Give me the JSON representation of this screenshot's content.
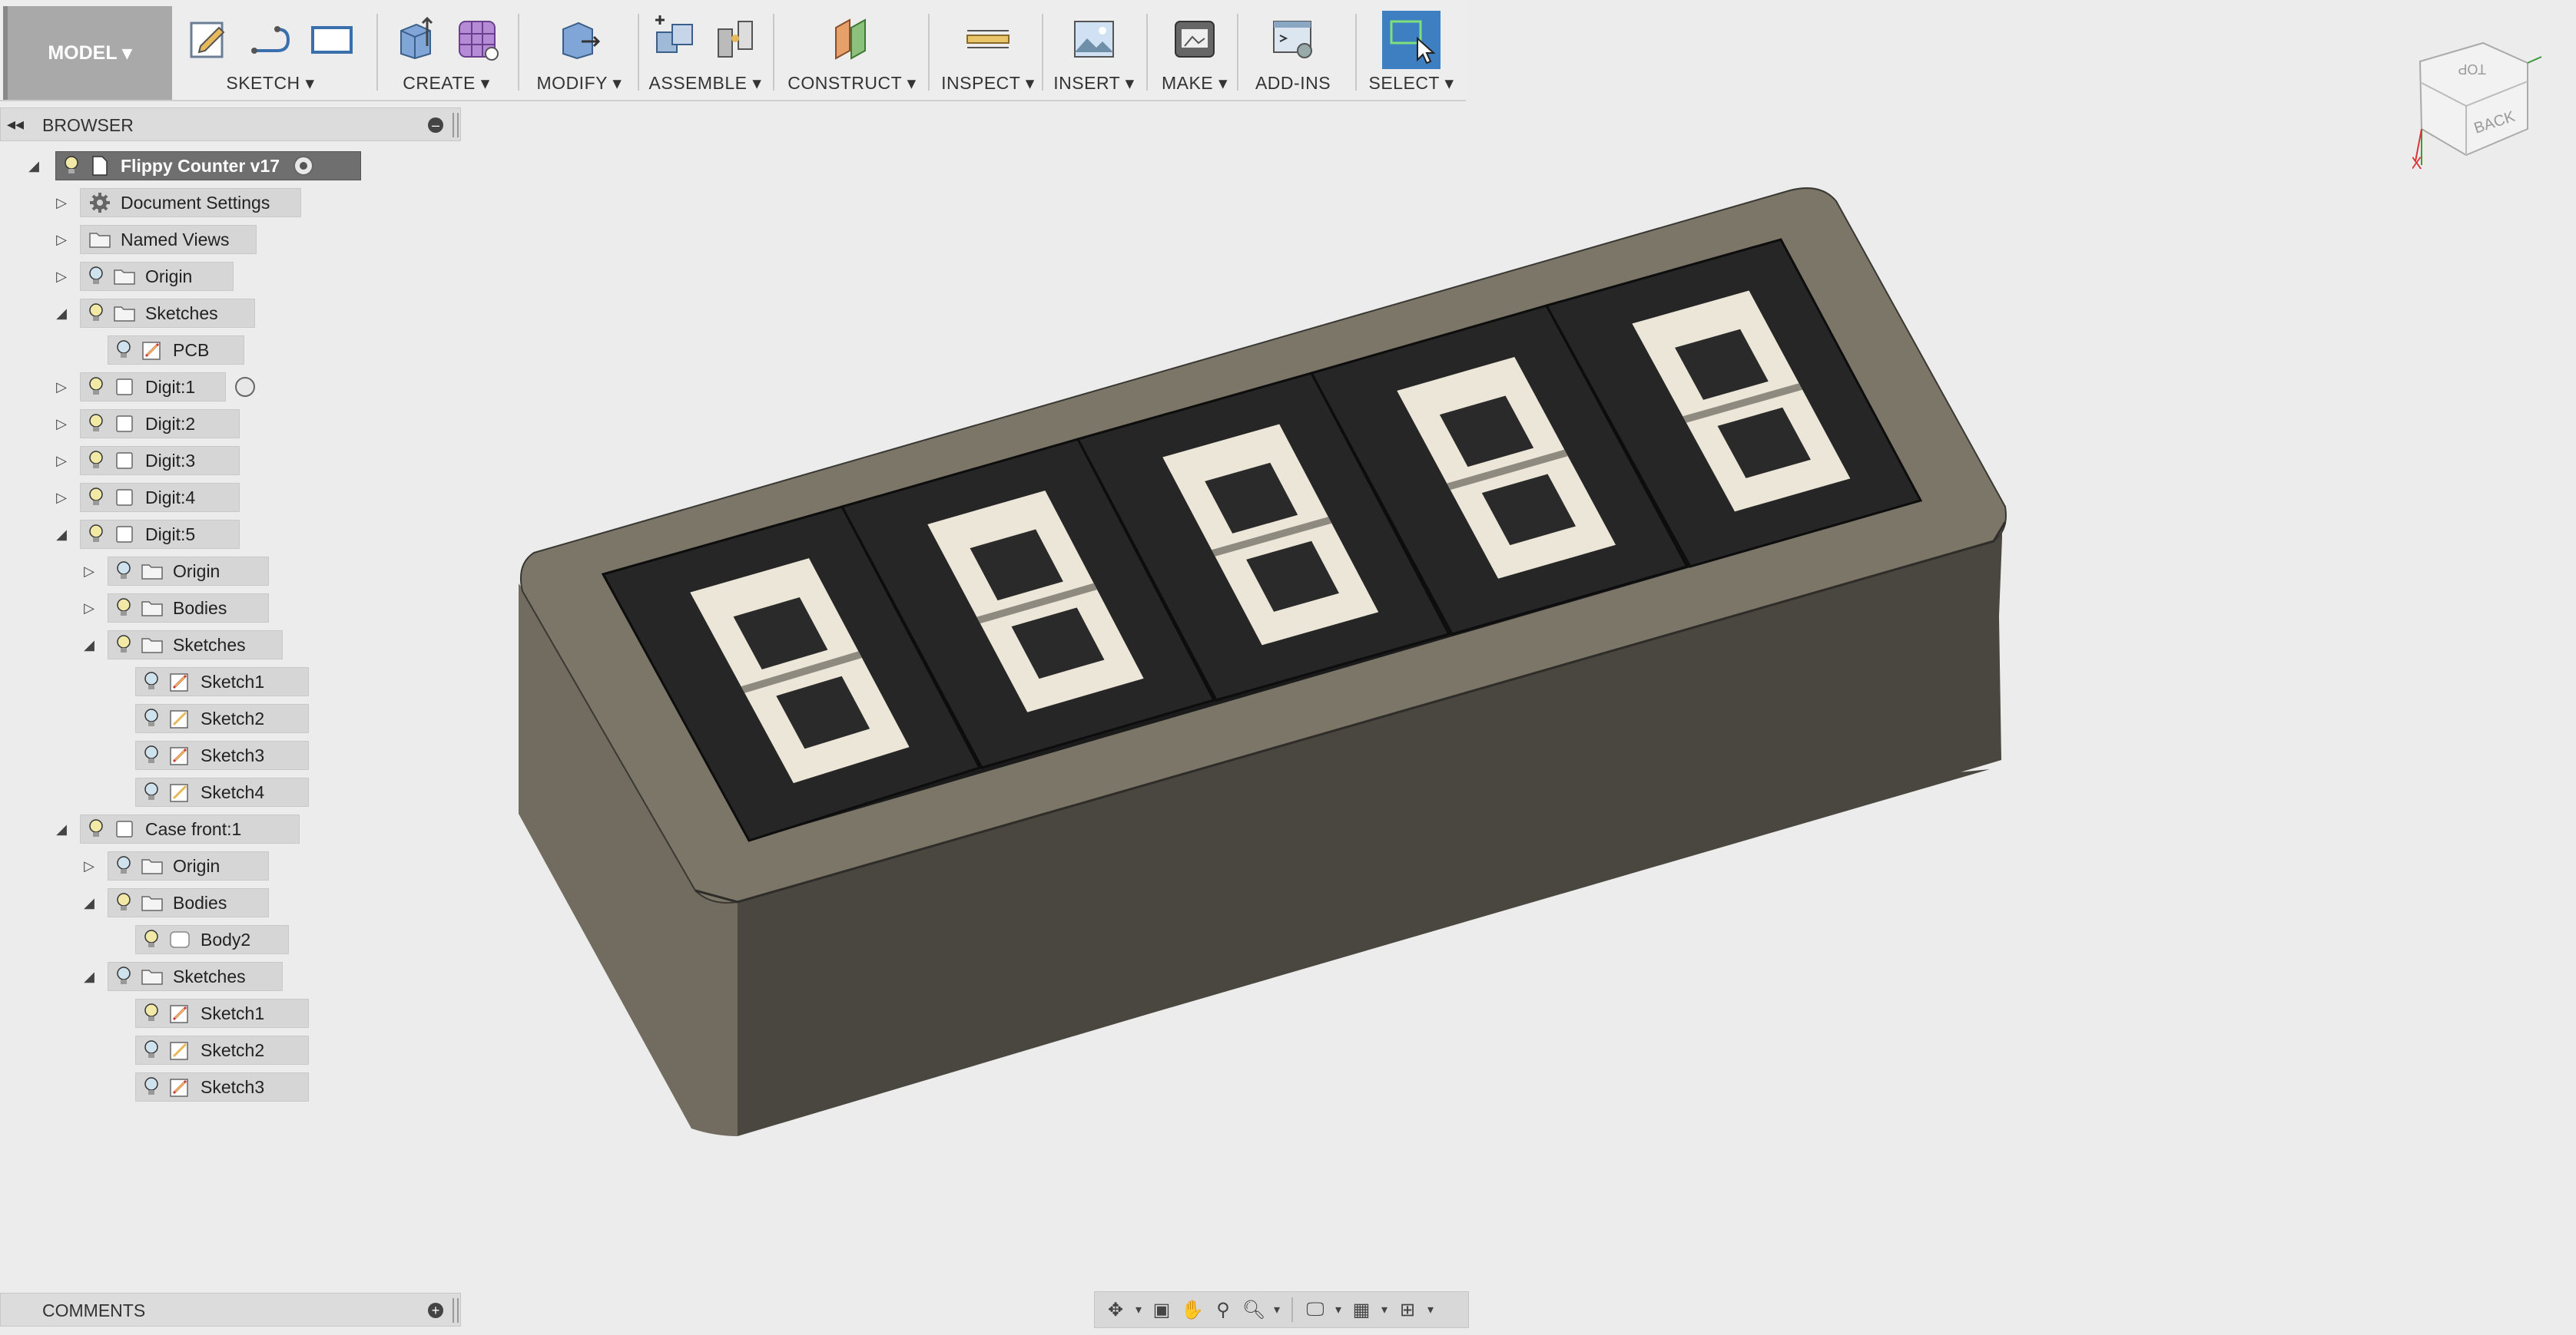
{
  "toolbar": {
    "workspace": "MODEL ▾",
    "groups": [
      {
        "label": "SKETCH ▾"
      },
      {
        "label": "CREATE ▾"
      },
      {
        "label": "MODIFY ▾"
      },
      {
        "label": "ASSEMBLE ▾"
      },
      {
        "label": "CONSTRUCT ▾"
      },
      {
        "label": "INSPECT ▾"
      },
      {
        "label": "INSERT ▾"
      },
      {
        "label": "MAKE ▾"
      },
      {
        "label": "ADD-INS"
      },
      {
        "label": "SELECT ▾"
      }
    ]
  },
  "browser": {
    "title": "BROWSER",
    "root": "Flippy Counter v17",
    "items": [
      {
        "label": "Document Settings"
      },
      {
        "label": "Named Views"
      },
      {
        "label": "Origin"
      },
      {
        "label": "Sketches"
      },
      {
        "label": "PCB"
      },
      {
        "label": "Digit:1"
      },
      {
        "label": "Digit:2"
      },
      {
        "label": "Digit:3"
      },
      {
        "label": "Digit:4"
      },
      {
        "label": "Digit:5"
      },
      {
        "label": "Origin"
      },
      {
        "label": "Bodies"
      },
      {
        "label": "Sketches"
      },
      {
        "label": "Sketch1"
      },
      {
        "label": "Sketch2"
      },
      {
        "label": "Sketch3"
      },
      {
        "label": "Sketch4"
      },
      {
        "label": "Case front:1"
      },
      {
        "label": "Origin"
      },
      {
        "label": "Bodies"
      },
      {
        "label": "Body2"
      },
      {
        "label": "Sketches"
      },
      {
        "label": "Sketch1"
      },
      {
        "label": "Sketch2"
      },
      {
        "label": "Sketch3"
      }
    ]
  },
  "comments": {
    "title": "COMMENTS"
  },
  "viewcube": {
    "top": "TOP",
    "back": "BACK",
    "x_axis": "X"
  },
  "colors": {
    "accent_select": "#3d7fc1",
    "case": "#4a4740",
    "rim": "#7c7669",
    "tile": "#262626",
    "segment": "#ece6d8"
  }
}
